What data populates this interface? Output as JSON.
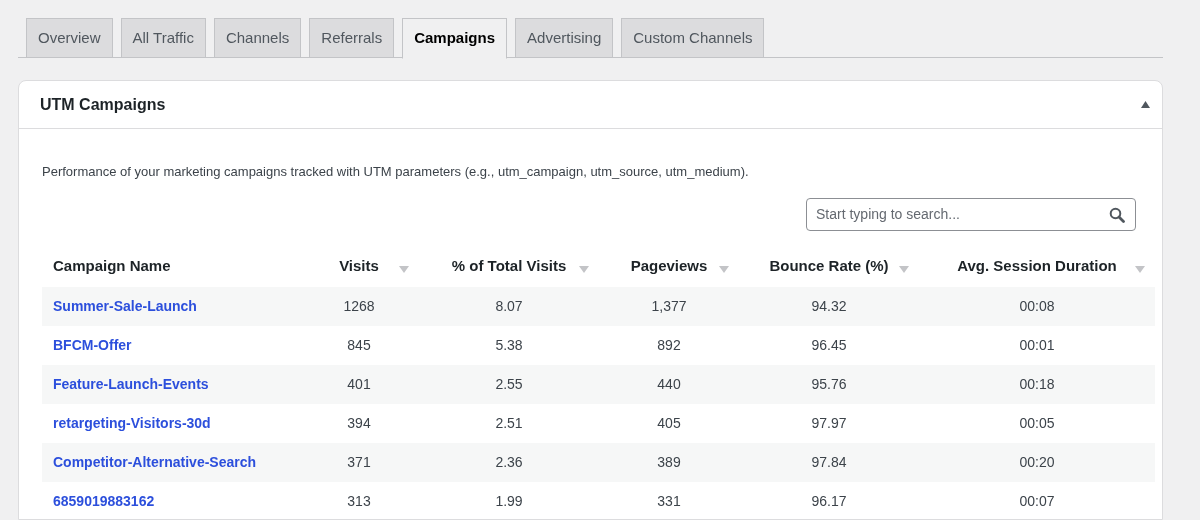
{
  "tabs": [
    {
      "label": "Overview",
      "selected": false
    },
    {
      "label": "All Traffic",
      "selected": false
    },
    {
      "label": "Channels",
      "selected": false
    },
    {
      "label": "Referrals",
      "selected": false
    },
    {
      "label": "Campaigns",
      "selected": true
    },
    {
      "label": "Advertising",
      "selected": false
    },
    {
      "label": "Custom Channels",
      "selected": false
    }
  ],
  "panel": {
    "title": "UTM Campaigns",
    "expanded": true,
    "description": "Performance of your marketing campaigns tracked with UTM parameters (e.g., utm_campaign, utm_source, utm_medium).",
    "search": {
      "placeholder": "Start typing to search..."
    },
    "table": {
      "columns": [
        "Campaign Name",
        "Visits",
        "% of Total Visits",
        "Pageviews",
        "Bounce Rate (%)",
        "Avg. Session Duration"
      ],
      "rows": [
        [
          "Summer-Sale-Launch",
          "1268",
          "8.07",
          "1,377",
          "94.32",
          "00:08"
        ],
        [
          "BFCM-Offer",
          "845",
          "5.38",
          "892",
          "96.45",
          "00:01"
        ],
        [
          "Feature-Launch-Events",
          "401",
          "2.55",
          "440",
          "95.76",
          "00:18"
        ],
        [
          "retargeting-Visitors-30d",
          "394",
          "2.51",
          "405",
          "97.97",
          "00:05"
        ],
        [
          "Competitor-Alternative-Search",
          "371",
          "2.36",
          "389",
          "97.84",
          "00:20"
        ],
        [
          "6859019883162",
          "313",
          "1.99",
          "331",
          "96.17",
          "00:07"
        ]
      ]
    }
  }
}
